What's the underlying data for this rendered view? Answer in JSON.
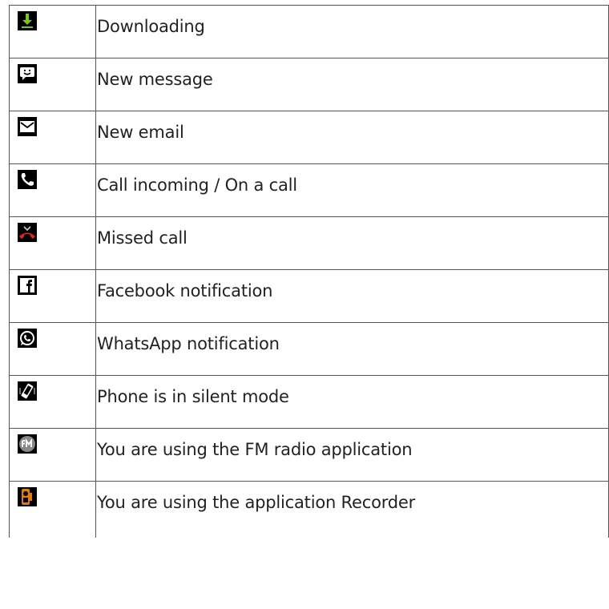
{
  "rows": [
    {
      "icon": "download-icon",
      "label": "Downloading"
    },
    {
      "icon": "message-icon",
      "label": "New message"
    },
    {
      "icon": "email-icon",
      "label": "New email"
    },
    {
      "icon": "phone-call-icon",
      "label": "Call incoming / On a call"
    },
    {
      "icon": "missed-call-icon",
      "label": "Missed call"
    },
    {
      "icon": "facebook-icon",
      "label": "Facebook notification"
    },
    {
      "icon": "whatsapp-icon",
      "label": "WhatsApp notification"
    },
    {
      "icon": "silent-mode-icon",
      "label": "Phone is in silent mode"
    },
    {
      "icon": "fm-radio-icon",
      "label": "You are using the FM radio application"
    },
    {
      "icon": "recorder-icon",
      "label": "You are using the application Recorder"
    }
  ],
  "colors": {
    "download": "#7bc61c",
    "missed_call": "#e8261c",
    "recorder": "#e07b0c",
    "fm_badge": "#888888",
    "border": "#555555"
  }
}
